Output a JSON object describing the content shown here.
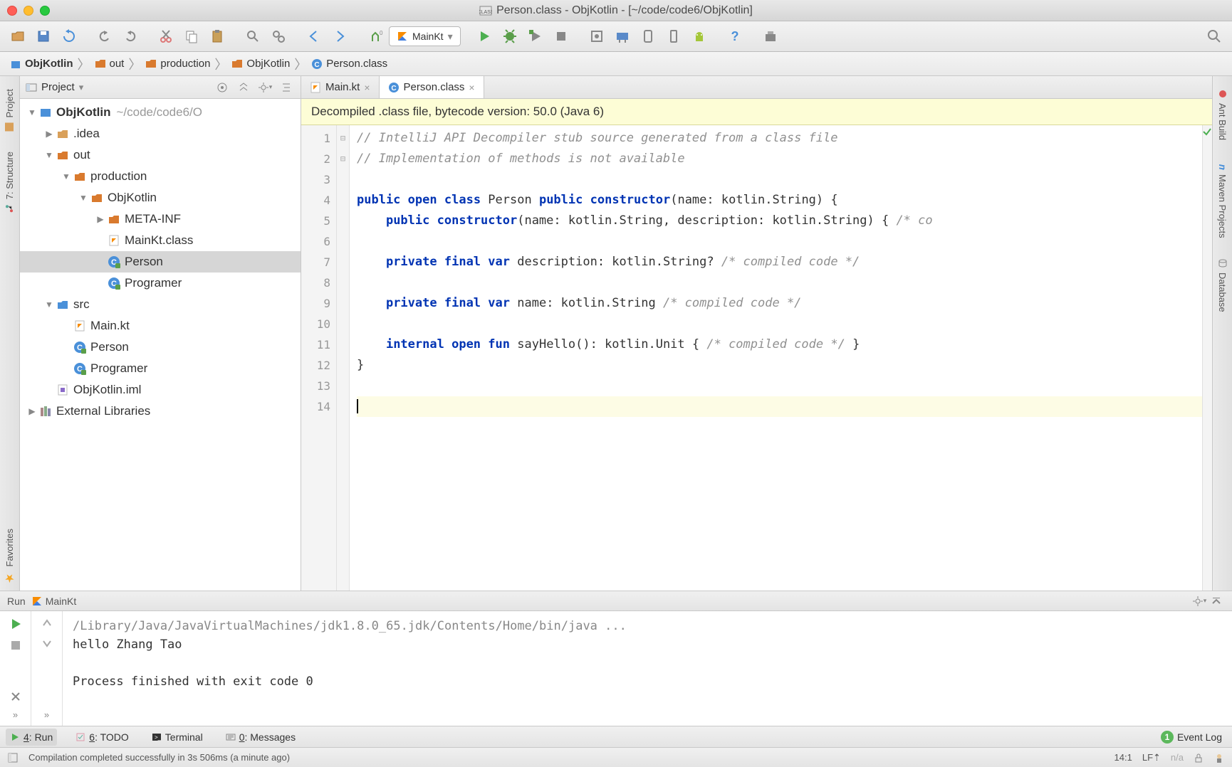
{
  "window": {
    "title": "Person.class - ObjKotlin - [~/code/code6/ObjKotlin]"
  },
  "runConfig": "MainKt",
  "breadcrumbs": [
    "ObjKotlin",
    "out",
    "production",
    "ObjKotlin",
    "Person.class"
  ],
  "leftTabs": [
    "Project",
    "7: Structure"
  ],
  "rightTabs": [
    "Ant Build",
    "Maven Projects",
    "Database"
  ],
  "projectPanel": {
    "title": "Project"
  },
  "tree": {
    "root": "ObjKotlin",
    "rootPath": "~/code/code6/O",
    "idea": ".idea",
    "out": "out",
    "production": "production",
    "objkotlin": "ObjKotlin",
    "metainf": "META-INF",
    "mainktClass": "MainKt.class",
    "person": "Person",
    "programer": "Programer",
    "src": "src",
    "mainkt": "Main.kt",
    "srcPerson": "Person",
    "srcProgramer": "Programer",
    "iml": "ObjKotlin.iml",
    "ext": "External Libraries"
  },
  "tabs": [
    {
      "label": "Main.kt",
      "active": false
    },
    {
      "label": "Person.class",
      "active": true
    }
  ],
  "banner": "Decompiled .class file, bytecode version: 50.0 (Java 6)",
  "code": {
    "l1": "// IntelliJ API Decompiler stub source generated from a class file",
    "l2": "// Implementation of methods is not available",
    "l4_a": "public",
    "l4_b": "open",
    "l4_c": "class",
    "l4_d": " Person ",
    "l4_e": "public",
    "l4_f": "constructor",
    "l4_g": "(name: kotlin.String) {",
    "l5_a": "public",
    "l5_b": "constructor",
    "l5_c": "(name: kotlin.String, description: kotlin.String) { ",
    "l5_d": "/* co",
    "l7_a": "private",
    "l7_b": "final",
    "l7_c": "var",
    "l7_d": " description: kotlin.String? ",
    "l7_e": "/* compiled code */",
    "l9_a": "private",
    "l9_b": "final",
    "l9_c": "var",
    "l9_d": " name: kotlin.String ",
    "l9_e": "/* compiled code */",
    "l11_a": "internal",
    "l11_b": "open",
    "l11_c": "fun",
    "l11_d": " sayHello(): kotlin.Unit { ",
    "l11_e": "/* compiled code */",
    "l11_f": " }",
    "l12": "}"
  },
  "lineNumbers": [
    "1",
    "2",
    "3",
    "4",
    "5",
    "6",
    "7",
    "8",
    "9",
    "10",
    "11",
    "12",
    "13",
    "14"
  ],
  "runPanel": {
    "title": "Run",
    "config": "MainKt",
    "cmd": "/Library/Java/JavaVirtualMachines/jdk1.8.0_65.jdk/Contents/Home/bin/java ...",
    "out1": "hello Zhang Tao",
    "out2": "Process finished with exit code 0"
  },
  "bottomTabs": {
    "run": "4: Run",
    "todo": "6: TODO",
    "terminal": "Terminal",
    "messages": "0: Messages",
    "eventlog": "Event Log",
    "eventBadge": "1"
  },
  "status": {
    "msg": "Compilation completed successfully in 3s 506ms (a minute ago)",
    "pos": "14:1",
    "le": "LF⇡",
    "enc": "n/a"
  }
}
